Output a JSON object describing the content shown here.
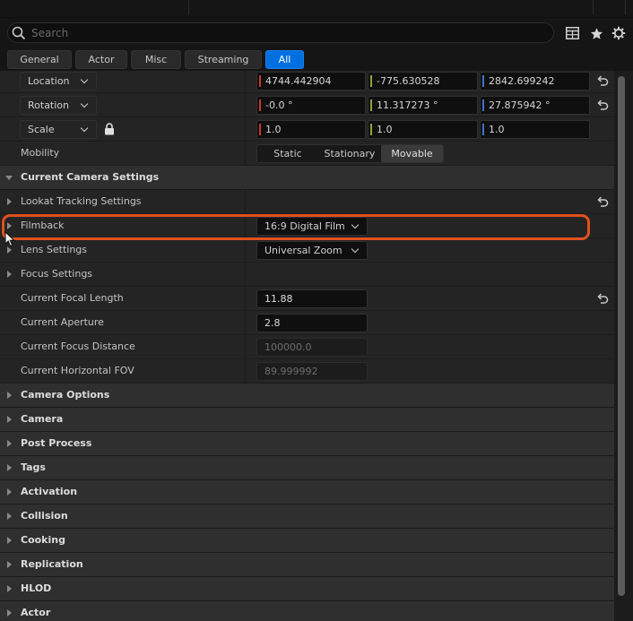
{
  "search": {
    "placeholder": "Search"
  },
  "filter_tabs": [
    "General",
    "Actor",
    "Misc",
    "Streaming",
    "All"
  ],
  "active_filter": "All",
  "transform": {
    "location": {
      "label": "Location",
      "x": "4744.442904",
      "y": "-775.630528",
      "z": "2842.699242"
    },
    "rotation": {
      "label": "Rotation",
      "x": "-0.0 °",
      "y": "11.317273 °",
      "z": "27.875942 °"
    },
    "scale": {
      "label": "Scale",
      "x": "1.0",
      "y": "1.0",
      "z": "1.0"
    },
    "mobility": {
      "label": "Mobility",
      "options": [
        "Static",
        "Stationary",
        "Movable"
      ],
      "selected": "Movable"
    }
  },
  "camera_settings": {
    "title": "Current Camera Settings",
    "lookat": "Lookat Tracking Settings",
    "filmback": {
      "label": "Filmback",
      "value": "16:9 Digital Film"
    },
    "lens": {
      "label": "Lens Settings",
      "value": "Universal Zoom"
    },
    "focus": "Focus Settings",
    "focal_length": {
      "label": "Current Focal Length",
      "value": "11.88"
    },
    "aperture": {
      "label": "Current Aperture",
      "value": "2.8"
    },
    "focus_distance": {
      "label": "Current Focus Distance",
      "value": "100000.0"
    },
    "horizontal_fov": {
      "label": "Current Horizontal FOV",
      "value": "89.999992"
    }
  },
  "categories": [
    "Camera Options",
    "Camera",
    "Post Process",
    "Tags",
    "Activation",
    "Collision",
    "Cooking",
    "Replication",
    "HLOD",
    "Actor"
  ],
  "colors": {
    "axis_x": "#c8392c",
    "axis_y": "#8aa631",
    "axis_z": "#3b75c9",
    "accent": "#0070e0",
    "highlight": "#e1501d"
  },
  "icons": [
    "search-icon",
    "table-view-icon",
    "favorite-star-icon",
    "settings-gear-icon",
    "lock-icon",
    "reset-arrow-icon",
    "mouse-cursor-icon"
  ]
}
